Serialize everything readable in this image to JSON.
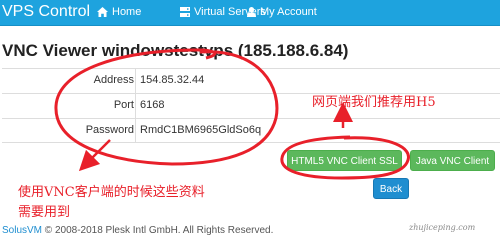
{
  "nav": {
    "brand": "VPS Control",
    "items": [
      {
        "label": "Home",
        "icon": "home-icon"
      },
      {
        "label": "Virtual Servers",
        "icon": "server-icon"
      },
      {
        "label": "My Account",
        "icon": "user-icon"
      }
    ]
  },
  "page": {
    "title": "VNC Viewer windowstestvps (185.188.6.84)"
  },
  "details": [
    {
      "key": "Address",
      "value": "154.85.32.44"
    },
    {
      "key": "Port",
      "value": "6168"
    },
    {
      "key": "Password",
      "value": "RmdC1BM6965GldSo6q"
    }
  ],
  "buttons": {
    "html5": "HTML5 VNC Client SSL",
    "java": "Java VNC Client",
    "back": "Back"
  },
  "footer": {
    "brand": "SolusVM",
    "text": "© 2008-2018 Plesk Intl GmbH. All Rights Reserved."
  },
  "annotations": {
    "h5_note": "网页端我们推荐用H5",
    "vnc_note_line1": "使用VNC客户端的时候这些资料",
    "vnc_note_line2": "需要用到",
    "watermark": "zhujiceping.com",
    "color": "#e8202a"
  },
  "colors": {
    "navbar": "#1ea3de",
    "success": "#5cb85c",
    "primary": "#1f8ed0"
  }
}
